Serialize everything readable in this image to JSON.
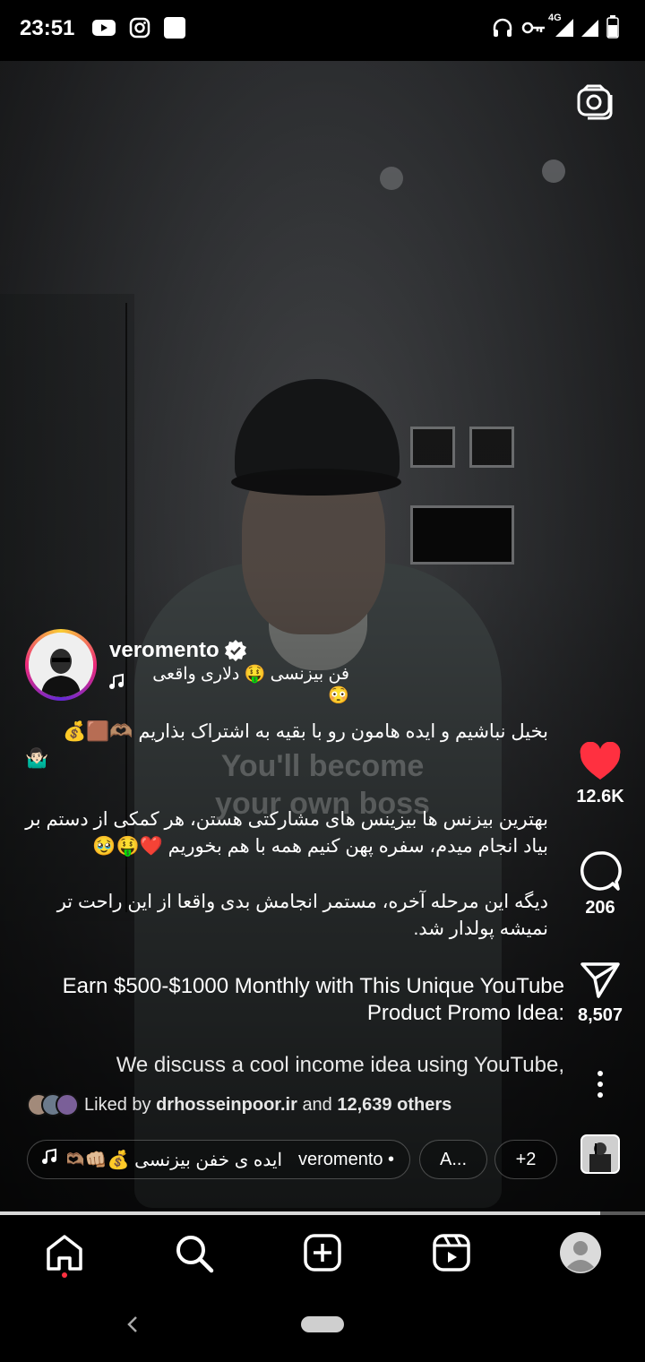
{
  "status_bar": {
    "time": "23:51",
    "network": "4G"
  },
  "post": {
    "username": "veromento",
    "audio": {
      "title": "فن بیزنسی 🤑 دلاری واقعی 😳"
    },
    "video_overlay": {
      "line1": "You'll become",
      "line2": "your own boss"
    },
    "caption": {
      "p1": "بخیل نباشیم و ایده هامون رو با بقیه به اشتراک بذاریم 🫶🏽🟫💰",
      "p1b": "🤷🏻‍♂️",
      "p2": "بهترین بیزنس ها بیزینس های مشارکتی هستن، هر کمکی از دستم بر بیاد انجام میدم، سفره پهن کنیم همه با هم بخوریم ❤️🤑🥹",
      "p3": "دیگه این مرحله آخره، مستمر انجامش بدی واقعا از این راحت تر نمیشه پولدار شد.",
      "en1": "Earn $500-$1000 Monthly with This Unique YouTube Product Promo Idea:",
      "en2": "We discuss a cool income idea using YouTube,"
    },
    "likes": {
      "prefix": "Liked by",
      "user": "drhosseinpoor.ir",
      "and": "and",
      "others": "12,639 others"
    },
    "actions": {
      "likes": "12.6K",
      "comments": "206",
      "shares": "8,507"
    },
    "pills": {
      "audio_label": "ایده ی خفن بیزنسی 💰👊🏼🫶🏽",
      "audio_user": "veromento •",
      "tag": "A...",
      "more": "+2"
    },
    "progress_fraction": 0.93
  },
  "colors": {
    "heart": "#ff3040",
    "accent": "#ffffff",
    "live_dot": "#ff3040"
  },
  "nav": {
    "items": [
      "home-icon",
      "search-icon",
      "create-icon",
      "reels-icon",
      "profile-avatar"
    ]
  }
}
